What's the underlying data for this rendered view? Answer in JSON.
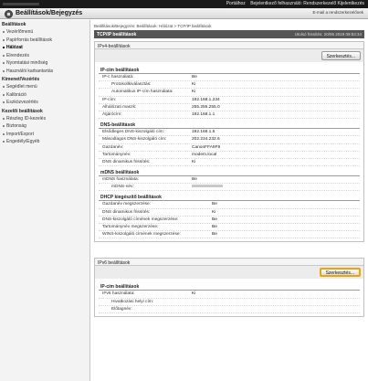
{
  "topbar": {
    "links": [
      "Portálhoz",
      "Bejelentkező felhasználó: Rendszerkezelő Kijelentkezés"
    ]
  },
  "titlebar": {
    "title": "Beállítások/Bejegyzés",
    "mail_link": "E-mail a rendszerkezelőnek"
  },
  "sidebar": {
    "sections": [
      {
        "label": "Beállítások",
        "items": [
          "Vezérlőmenü",
          "Papírforrás beállítások",
          "Hálózat",
          "Elrendezés",
          "Nyomtatási minőség",
          "Használói karbantartás"
        ]
      },
      {
        "label": "Kimenet/Vezérlés",
        "items": [
          "Segédlet menü",
          "Kalibráció",
          "Eszközvezérlés"
        ]
      },
      {
        "label": "Kezelői beállítások",
        "items": [
          "Részleg ID-kezelés",
          "Biztonság",
          "Import/Export",
          "Engedély/Egyéb"
        ]
      }
    ],
    "active_item": "Hálózat"
  },
  "main": {
    "breadcrumb": "Beállítások/Bejegyzés: Beállítások: Hálózat > TCP/IP beállítások",
    "page_title": "TCP/IP beállítások",
    "last_update": "Utolsó frissítés: 20/06 2019 09:53:34",
    "ipv4": {
      "panel_title": "IPv4-beállítások",
      "edit_label": "Szerkesztés...",
      "groups": [
        {
          "title": "IP-cím beállítások",
          "rows": [
            {
              "key": "IP-c használatá:",
              "value": "Be",
              "indent": false
            },
            {
              "key": "Protokollkiválasztás:",
              "value": "Ki",
              "indent": true
            },
            {
              "key": "Automatikus IP-cím használata:",
              "value": "Ki",
              "indent": true
            },
            {
              "key": "IP-cím:",
              "value": "192.168.1.234",
              "indent": false
            },
            {
              "key": "Alhálózati maszk:",
              "value": "255.255.255.0",
              "indent": false
            },
            {
              "key": "Átjárócím:",
              "value": "192.168.1.1",
              "indent": false
            }
          ]
        },
        {
          "title": "DNS-beállítások",
          "rows": [
            {
              "key": "Elsődleges DNS-kiszolgáló cím:",
              "value": "192.168.1.5",
              "indent": false
            },
            {
              "key": "Másodlagos DNS-kiszolgáló cím:",
              "value": "202.234.232.6",
              "indent": false
            },
            {
              "key": "Gazdanév:",
              "value": "CanonFFA9F9",
              "indent": false
            },
            {
              "key": "Tartománynév:",
              "value": "modem.local",
              "indent": false
            },
            {
              "key": "DNS dinamikus frissítés:",
              "value": "Ki",
              "indent": false
            }
          ]
        },
        {
          "title": "mDNS beállítások",
          "rows": [
            {
              "key": "mDNS használata:",
              "value": "Be",
              "indent": false
            },
            {
              "key": "mDNS-név:",
              "value": "",
              "indent": true,
              "redacted": true
            }
          ]
        },
        {
          "title": "DHCP kiegészítő beállítások",
          "wide": true,
          "rows": [
            {
              "key": "Gazdanév megszerzése:",
              "value": "Be",
              "indent": false
            },
            {
              "key": "DNS dinamikus frissítés:",
              "value": "Ki",
              "indent": false
            },
            {
              "key": "DNS-kiszolgáló címének megszerzése:",
              "value": "Be",
              "indent": false
            },
            {
              "key": "Tartománynév megszerzése:",
              "value": "Be",
              "indent": false
            },
            {
              "key": "WINS-kiszolgáló címének megszerzése:",
              "value": "Be",
              "indent": false
            }
          ]
        }
      ]
    },
    "ipv6": {
      "panel_title": "IPv6 beállítások",
      "edit_label": "Szerkesztés...",
      "groups": [
        {
          "title": "IP-cím beállítások",
          "rows": [
            {
              "key": "IPv6 használata:",
              "value": "Ki",
              "indent": false
            },
            {
              "key": "Hivatkozási helyi cím:",
              "value": "",
              "indent": true
            },
            {
              "key": "Előtagnév:",
              "value": "",
              "indent": true
            }
          ]
        }
      ]
    }
  }
}
